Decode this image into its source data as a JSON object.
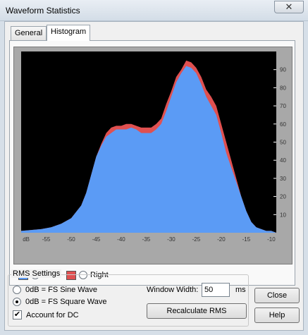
{
  "window": {
    "title": "Waveform Statistics",
    "close_glyph": "✕"
  },
  "tabs": [
    {
      "label": "General",
      "active": false
    },
    {
      "label": "Histogram",
      "active": true
    }
  ],
  "legend": {
    "left": {
      "label": "Left",
      "selected": true,
      "color": "#5b9bf5"
    },
    "right": {
      "label": "Right",
      "selected": false,
      "color": "#e05050"
    }
  },
  "rms": {
    "title": "RMS Settings",
    "sine_label": "0dB = FS Sine Wave",
    "square_label": "0dB = FS Square Wave",
    "selected": "square",
    "dc_label": "Account for DC",
    "dc_checked": true,
    "window_width_label": "Window Width:",
    "window_width_value": "50",
    "window_width_unit": "ms",
    "recalc_label": "Recalculate RMS"
  },
  "buttons": {
    "close": "Close",
    "help": "Help"
  },
  "chart_data": {
    "type": "area",
    "title": "",
    "xlabel": "dB",
    "ylabel": "",
    "xlim": [
      -60,
      -9
    ],
    "ylim": [
      0,
      100
    ],
    "x_ticks": [
      "dB",
      "-55",
      "-50",
      "-45",
      "-40",
      "-35",
      "-30",
      "-25",
      "-20",
      "-15",
      "-10"
    ],
    "y_ticks": [
      "10",
      "20",
      "30",
      "40",
      "50",
      "60",
      "70",
      "80",
      "90"
    ],
    "background": "#000000",
    "series": [
      {
        "name": "Left",
        "color": "#5b9bf5",
        "x": [
          -60,
          -58,
          -56,
          -54,
          -52,
          -50,
          -48,
          -47,
          -46,
          -45,
          -44,
          -43,
          -42,
          -41,
          -40,
          -39,
          -38,
          -37,
          -36,
          -35,
          -34,
          -33,
          -32,
          -31,
          -30,
          -29,
          -28,
          -27,
          -26,
          -25,
          -24,
          -23,
          -22,
          -21,
          -20,
          -19,
          -18,
          -17,
          -16,
          -15,
          -14,
          -13,
          -12,
          -11,
          -10,
          -9
        ],
        "y": [
          1,
          1.5,
          2,
          3,
          5,
          8,
          15,
          22,
          32,
          42,
          48,
          53,
          55,
          57,
          57,
          57,
          58,
          57,
          55,
          55,
          55,
          57,
          60,
          67,
          75,
          83,
          88,
          92,
          91,
          88,
          82,
          75,
          70,
          65,
          55,
          44,
          36,
          28,
          20,
          12,
          6,
          3,
          2,
          1,
          1,
          0
        ]
      },
      {
        "name": "Right",
        "color": "#e05050",
        "x": [
          -60,
          -58,
          -56,
          -54,
          -52,
          -50,
          -48,
          -47,
          -46,
          -45,
          -44,
          -43,
          -42,
          -41,
          -40,
          -39,
          -38,
          -37,
          -36,
          -35,
          -34,
          -33,
          -32,
          -31,
          -30,
          -29,
          -28,
          -27,
          -26,
          -25,
          -24,
          -23,
          -22,
          -21,
          -20,
          -19,
          -18,
          -17,
          -16,
          -15,
          -14,
          -13,
          -12,
          -11,
          -10,
          -9
        ],
        "y": [
          1,
          1.5,
          2,
          3,
          5,
          8,
          15,
          22,
          32,
          42,
          49,
          55,
          58,
          59,
          59,
          60,
          60,
          59,
          58,
          58,
          58,
          60,
          63,
          71,
          78,
          86,
          90,
          95,
          94,
          91,
          86,
          79,
          75,
          70,
          60,
          50,
          40,
          30,
          20,
          12,
          6,
          3,
          2,
          1,
          1,
          0
        ]
      }
    ]
  }
}
